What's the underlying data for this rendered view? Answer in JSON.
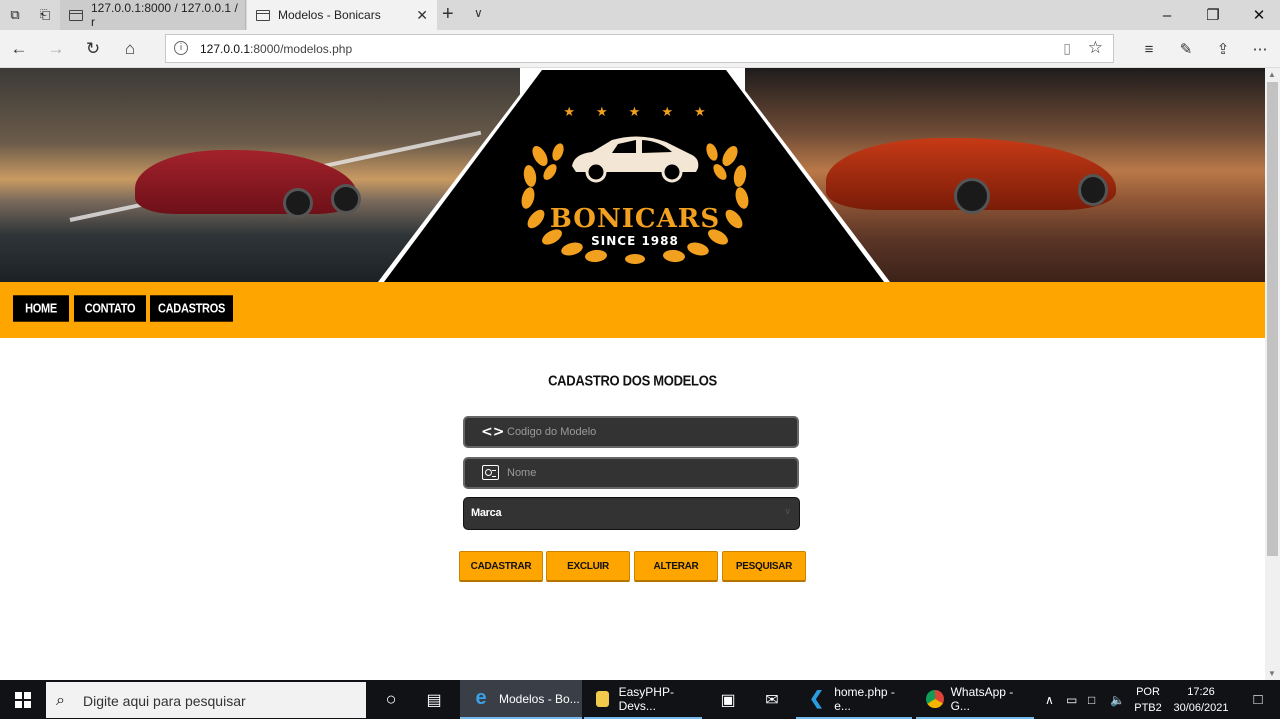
{
  "browser": {
    "tabs": [
      {
        "title": "127.0.0.1:8000 / 127.0.0.1 / r",
        "active": false
      },
      {
        "title": "Modelos - Bonicars",
        "active": true
      }
    ],
    "url_host": "127.0.0.1",
    "url_rest": ":8000/modelos.php"
  },
  "page": {
    "brand": "BONICARS",
    "since": "SINCE 1988",
    "nav": [
      "HOME",
      "CONTATO",
      "CADASTROS"
    ],
    "form_title": "CADASTRO DOS MODELOS",
    "fields": {
      "codigo_placeholder": "Codigo do Modelo",
      "nome_placeholder": "Nome",
      "marca_selected": "Marca"
    },
    "buttons": [
      "CADASTRAR",
      "EXCLUIR",
      "ALTERAR",
      "PESQUISAR"
    ]
  },
  "colors": {
    "accent": "#ffa500",
    "field_bg": "#333333",
    "nav_button_bg": "#000000"
  },
  "taskbar": {
    "search_placeholder": "Digite aqui para pesquisar",
    "tasks": [
      {
        "label": "Modelos - Bo...",
        "icon": "edge-icon"
      },
      {
        "label": "EasyPHP-Devs...",
        "icon": "folder-icon"
      },
      {
        "label": "home.php - e...",
        "icon": "vscode-icon"
      },
      {
        "label": "WhatsApp - G...",
        "icon": "chrome-icon"
      }
    ],
    "lang_1": "POR",
    "lang_2": "PTB2",
    "time": "17:26",
    "date": "30/06/2021"
  }
}
